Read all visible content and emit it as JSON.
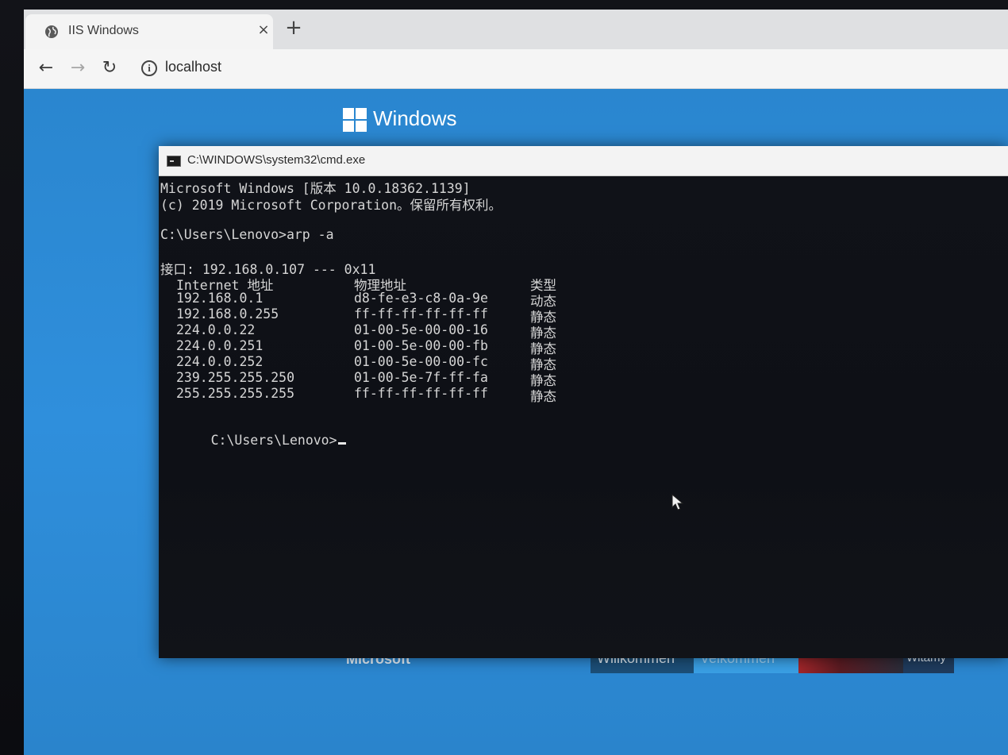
{
  "browser": {
    "tab_title": "IIS Windows",
    "tab_close": "×",
    "new_tab": "+",
    "back": "←",
    "forward": "→",
    "reload": "↻",
    "site_info": "i",
    "address": "localhost"
  },
  "iis_page": {
    "brand": "Windows",
    "footer_logo": "Microsoft",
    "welcome_tiles": [
      "Willkommen",
      "Velkommen",
      "",
      "Witamy"
    ]
  },
  "cmd": {
    "title": "C:\\WINDOWS\\system32\\cmd.exe",
    "lines": {
      "version": "Microsoft Windows [版本 10.0.18362.1139]",
      "copyright": "(c) 2019 Microsoft Corporation。保留所有权利。",
      "command": "C:\\Users\\Lenovo>arp -a",
      "interface": "接口: 192.168.0.107 --- 0x11",
      "prompt": "C:\\Users\\Lenovo>"
    },
    "table": {
      "headers": [
        "Internet 地址",
        "物理地址",
        "类型"
      ],
      "rows": [
        [
          "192.168.0.1",
          "d8-fe-e3-c8-0a-9e",
          "动态"
        ],
        [
          "192.168.0.255",
          "ff-ff-ff-ff-ff-ff",
          "静态"
        ],
        [
          "224.0.0.22",
          "01-00-5e-00-00-16",
          "静态"
        ],
        [
          "224.0.0.251",
          "01-00-5e-00-00-fb",
          "静态"
        ],
        [
          "224.0.0.252",
          "01-00-5e-00-00-fc",
          "静态"
        ],
        [
          "239.255.255.250",
          "01-00-5e-7f-ff-fa",
          "静态"
        ],
        [
          "255.255.255.255",
          "ff-ff-ff-ff-ff-ff",
          "静态"
        ]
      ]
    }
  },
  "colors": {
    "page_blue": "#2f8fdc",
    "console_bg": "#0e1016",
    "console_text": "#d6d6d6"
  }
}
